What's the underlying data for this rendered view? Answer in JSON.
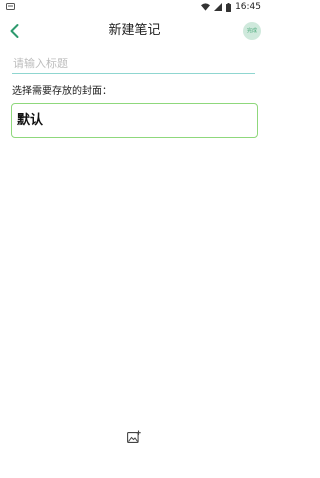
{
  "status_bar": {
    "time": "16:45",
    "icons": [
      "notification-icon",
      "wifi-icon",
      "signal-icon",
      "battery-icon"
    ]
  },
  "app_bar": {
    "title": "新建笔记",
    "back_icon": "chevron-left-icon",
    "done_label": "完成"
  },
  "form": {
    "title_placeholder": "请输入标题",
    "title_value": "",
    "cover_label": "选择需要存放的封面：",
    "cover_selected": "默认"
  },
  "toolbar": {
    "insert_image_icon": "image-add-icon"
  },
  "colors": {
    "accent": "#2e9a6e",
    "done_bg": "#cfe9dc",
    "input_underline": "#8fd6d0",
    "select_border": "#8fd87c"
  }
}
